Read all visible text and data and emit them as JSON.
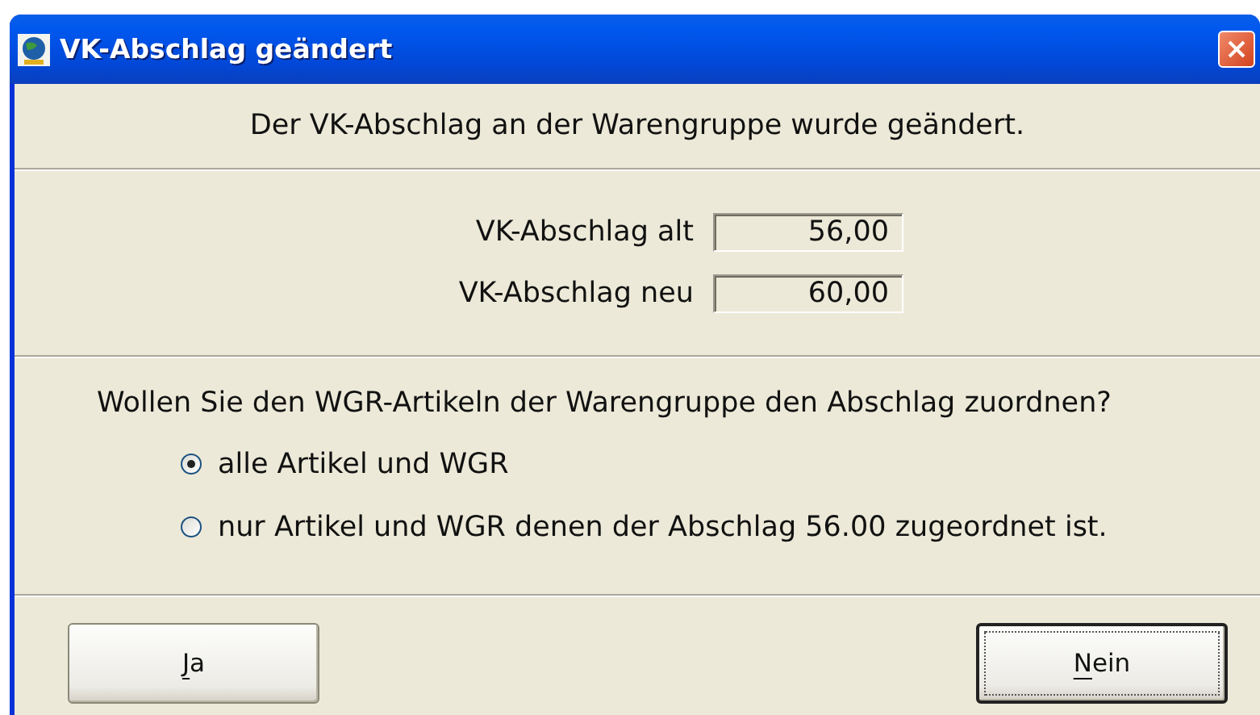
{
  "window": {
    "title": "VK-Abschlag geändert"
  },
  "message": "Der VK-Abschlag an der Warengruppe wurde geändert.",
  "fields": [
    {
      "label": "VK-Abschlag alt",
      "value": "56,00"
    },
    {
      "label": "VK-Abschlag neu",
      "value": "60,00"
    }
  ],
  "question": "Wollen Sie den WGR-Artikeln der Warengruppe den Abschlag zuordnen?",
  "options": [
    {
      "label": "alle Artikel und WGR",
      "selected": true
    },
    {
      "label": "nur Artikel und WGR denen der Abschlag 56.00 zugeordnet ist.",
      "selected": false
    }
  ],
  "buttons": [
    {
      "label": "Ja",
      "underline_first": true,
      "default": false
    },
    {
      "label": "Nein",
      "underline_first": true,
      "default": true
    }
  ]
}
